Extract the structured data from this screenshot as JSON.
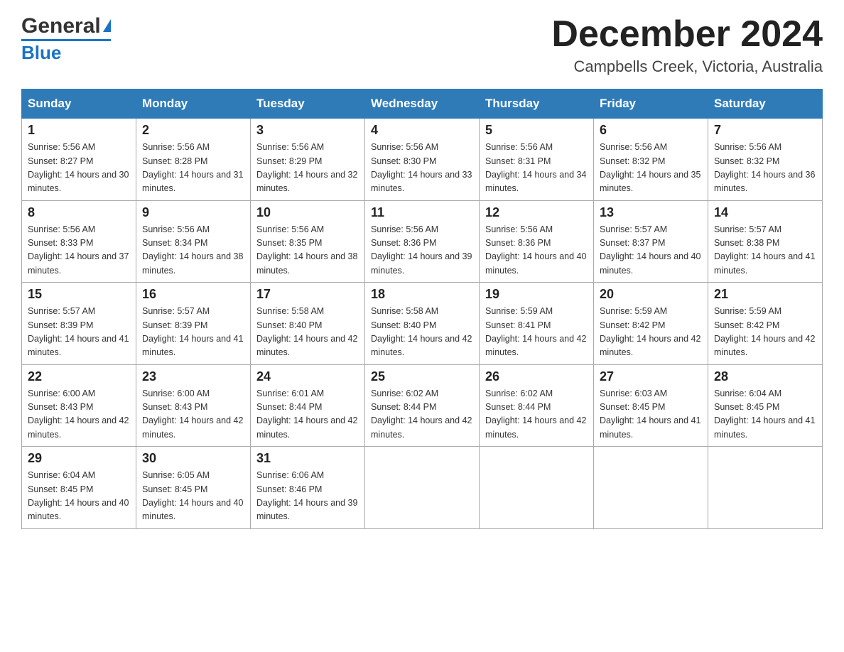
{
  "logo": {
    "name_part1": "General",
    "name_part2": "Blue"
  },
  "title": "December 2024",
  "subtitle": "Campbells Creek, Victoria, Australia",
  "days_of_week": [
    "Sunday",
    "Monday",
    "Tuesday",
    "Wednesday",
    "Thursday",
    "Friday",
    "Saturday"
  ],
  "weeks": [
    [
      {
        "day": "1",
        "sunrise": "5:56 AM",
        "sunset": "8:27 PM",
        "daylight": "14 hours and 30 minutes."
      },
      {
        "day": "2",
        "sunrise": "5:56 AM",
        "sunset": "8:28 PM",
        "daylight": "14 hours and 31 minutes."
      },
      {
        "day": "3",
        "sunrise": "5:56 AM",
        "sunset": "8:29 PM",
        "daylight": "14 hours and 32 minutes."
      },
      {
        "day": "4",
        "sunrise": "5:56 AM",
        "sunset": "8:30 PM",
        "daylight": "14 hours and 33 minutes."
      },
      {
        "day": "5",
        "sunrise": "5:56 AM",
        "sunset": "8:31 PM",
        "daylight": "14 hours and 34 minutes."
      },
      {
        "day": "6",
        "sunrise": "5:56 AM",
        "sunset": "8:32 PM",
        "daylight": "14 hours and 35 minutes."
      },
      {
        "day": "7",
        "sunrise": "5:56 AM",
        "sunset": "8:32 PM",
        "daylight": "14 hours and 36 minutes."
      }
    ],
    [
      {
        "day": "8",
        "sunrise": "5:56 AM",
        "sunset": "8:33 PM",
        "daylight": "14 hours and 37 minutes."
      },
      {
        "day": "9",
        "sunrise": "5:56 AM",
        "sunset": "8:34 PM",
        "daylight": "14 hours and 38 minutes."
      },
      {
        "day": "10",
        "sunrise": "5:56 AM",
        "sunset": "8:35 PM",
        "daylight": "14 hours and 38 minutes."
      },
      {
        "day": "11",
        "sunrise": "5:56 AM",
        "sunset": "8:36 PM",
        "daylight": "14 hours and 39 minutes."
      },
      {
        "day": "12",
        "sunrise": "5:56 AM",
        "sunset": "8:36 PM",
        "daylight": "14 hours and 40 minutes."
      },
      {
        "day": "13",
        "sunrise": "5:57 AM",
        "sunset": "8:37 PM",
        "daylight": "14 hours and 40 minutes."
      },
      {
        "day": "14",
        "sunrise": "5:57 AM",
        "sunset": "8:38 PM",
        "daylight": "14 hours and 41 minutes."
      }
    ],
    [
      {
        "day": "15",
        "sunrise": "5:57 AM",
        "sunset": "8:39 PM",
        "daylight": "14 hours and 41 minutes."
      },
      {
        "day": "16",
        "sunrise": "5:57 AM",
        "sunset": "8:39 PM",
        "daylight": "14 hours and 41 minutes."
      },
      {
        "day": "17",
        "sunrise": "5:58 AM",
        "sunset": "8:40 PM",
        "daylight": "14 hours and 42 minutes."
      },
      {
        "day": "18",
        "sunrise": "5:58 AM",
        "sunset": "8:40 PM",
        "daylight": "14 hours and 42 minutes."
      },
      {
        "day": "19",
        "sunrise": "5:59 AM",
        "sunset": "8:41 PM",
        "daylight": "14 hours and 42 minutes."
      },
      {
        "day": "20",
        "sunrise": "5:59 AM",
        "sunset": "8:42 PM",
        "daylight": "14 hours and 42 minutes."
      },
      {
        "day": "21",
        "sunrise": "5:59 AM",
        "sunset": "8:42 PM",
        "daylight": "14 hours and 42 minutes."
      }
    ],
    [
      {
        "day": "22",
        "sunrise": "6:00 AM",
        "sunset": "8:43 PM",
        "daylight": "14 hours and 42 minutes."
      },
      {
        "day": "23",
        "sunrise": "6:00 AM",
        "sunset": "8:43 PM",
        "daylight": "14 hours and 42 minutes."
      },
      {
        "day": "24",
        "sunrise": "6:01 AM",
        "sunset": "8:44 PM",
        "daylight": "14 hours and 42 minutes."
      },
      {
        "day": "25",
        "sunrise": "6:02 AM",
        "sunset": "8:44 PM",
        "daylight": "14 hours and 42 minutes."
      },
      {
        "day": "26",
        "sunrise": "6:02 AM",
        "sunset": "8:44 PM",
        "daylight": "14 hours and 42 minutes."
      },
      {
        "day": "27",
        "sunrise": "6:03 AM",
        "sunset": "8:45 PM",
        "daylight": "14 hours and 41 minutes."
      },
      {
        "day": "28",
        "sunrise": "6:04 AM",
        "sunset": "8:45 PM",
        "daylight": "14 hours and 41 minutes."
      }
    ],
    [
      {
        "day": "29",
        "sunrise": "6:04 AM",
        "sunset": "8:45 PM",
        "daylight": "14 hours and 40 minutes."
      },
      {
        "day": "30",
        "sunrise": "6:05 AM",
        "sunset": "8:45 PM",
        "daylight": "14 hours and 40 minutes."
      },
      {
        "day": "31",
        "sunrise": "6:06 AM",
        "sunset": "8:46 PM",
        "daylight": "14 hours and 39 minutes."
      },
      null,
      null,
      null,
      null
    ]
  ]
}
